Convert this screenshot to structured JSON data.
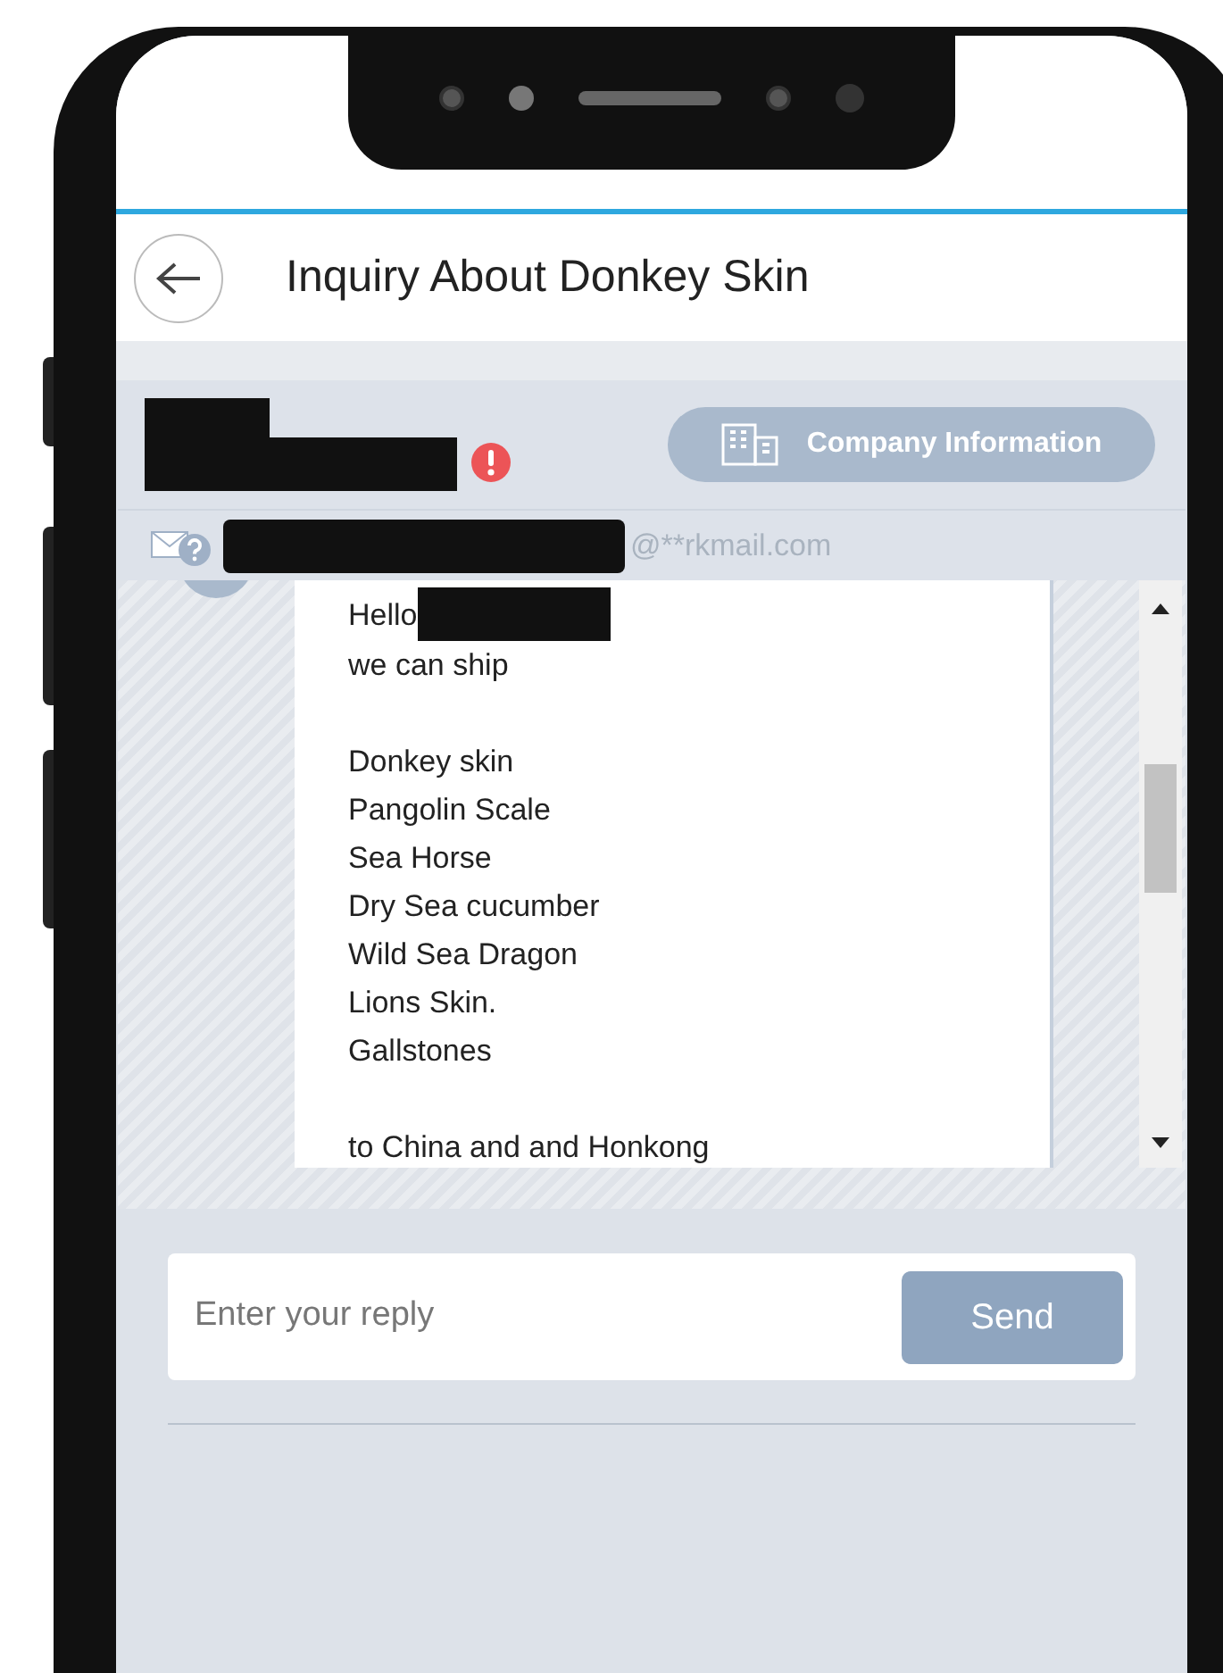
{
  "header": {
    "title": "Inquiry About Donkey Skin"
  },
  "sender": {
    "company_button": "Company Information",
    "email_domain": "@**rkmail.com"
  },
  "message": {
    "greeting": "Hello",
    "paragraphs": [
      [
        "we can ship"
      ],
      [
        "Donkey skin",
        "Pangolin Scale",
        "Sea Horse",
        "Dry Sea cucumber",
        "Wild Sea Dragon",
        "Lions Skin.",
        "Gallstones"
      ],
      [
        "to China and and Honkong"
      ]
    ]
  },
  "reply": {
    "placeholder": "Enter your reply",
    "send_button": "Send"
  }
}
